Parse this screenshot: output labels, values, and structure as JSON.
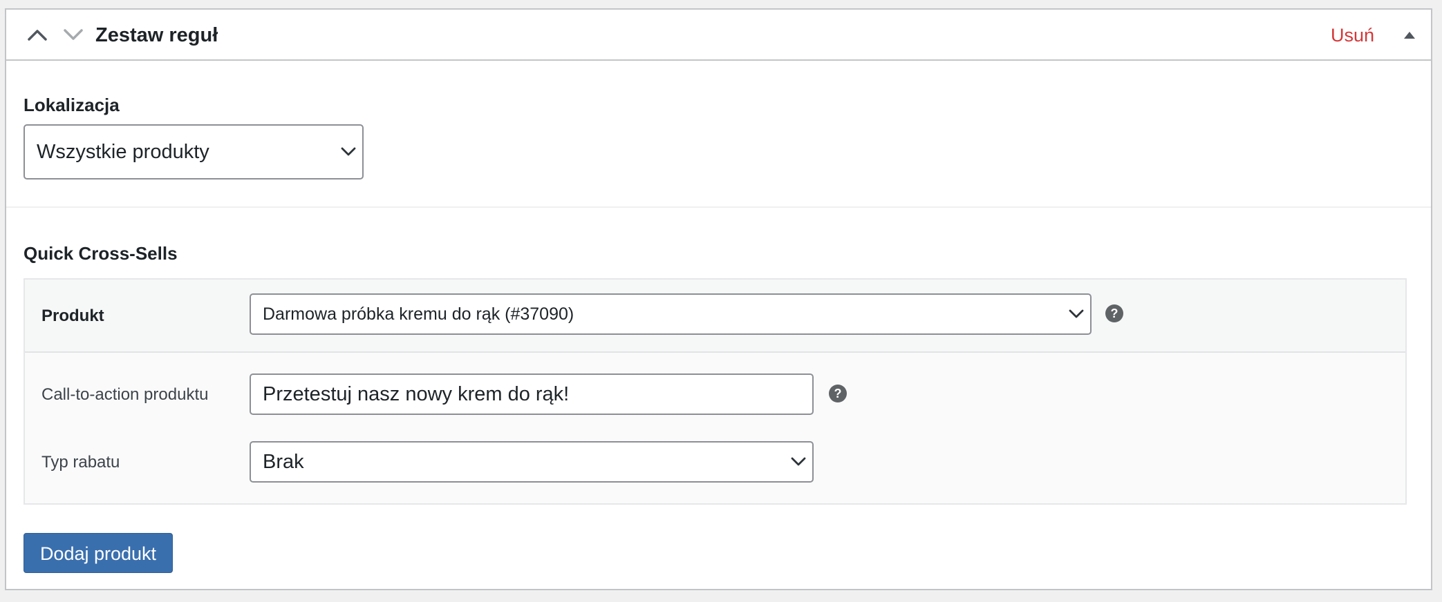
{
  "header": {
    "title": "Zestaw reguł",
    "remove_label": "Usuń",
    "move_up_icon": "chevron-up-icon",
    "move_down_icon": "chevron-down-icon",
    "toggle_icon": "triangle-up-icon"
  },
  "location": {
    "label": "Lokalizacja",
    "selected": "Wszystkie produkty"
  },
  "cross_sells": {
    "title": "Quick Cross-Sells",
    "product": {
      "label": "Produkt",
      "selected": "Darmowa próbka kremu do rąk (#37090)",
      "help": "?"
    },
    "cta": {
      "label": "Call-to-action produktu",
      "value": "Przetestuj nasz nowy krem do rąk!",
      "help": "?"
    },
    "discount": {
      "label": "Typ rabatu",
      "selected": "Brak"
    },
    "add_button": "Dodaj produkt"
  },
  "colors": {
    "remove": "#d63638",
    "primary_button": "#3a6fae",
    "border": "#c3c4c7"
  }
}
